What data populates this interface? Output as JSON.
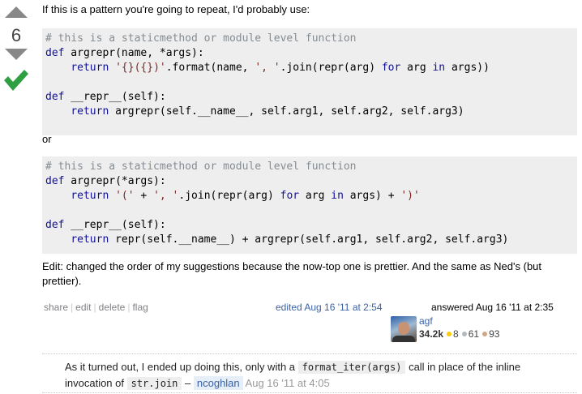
{
  "vote": {
    "count": "6"
  },
  "post": {
    "intro": "If this is a pattern you're going to repeat, I'd probably use:",
    "or": "or",
    "edit_note": "Edit: changed the order of my suggestions because the now-top one is prettier. And the same as Ned's (but prettier)."
  },
  "code1": {
    "l1": "# this is a staticmethod or module level function",
    "l2_kw": "def",
    "l2_rest": " argrepr(name, *args):",
    "l3_a": "    ",
    "l3_kw": "return",
    "l3_sp": " ",
    "l3_st1": "'{}({})'",
    "l3_m1": ".format(name, ",
    "l3_st2": "', '",
    "l3_m2": ".join(repr(arg) ",
    "l3_for": "for",
    "l3_m3": " arg ",
    "l3_in": "in",
    "l3_m4": " args))",
    "l5_kw": "def",
    "l5_rest": " __repr__(self):",
    "l6_a": "    ",
    "l6_kw": "return",
    "l6_rest": " argrepr(self.__name__, self.arg1, self.arg2, self.arg3)"
  },
  "code2": {
    "l1": "# this is a staticmethod or module level function",
    "l2_kw": "def",
    "l2_rest": " argrepr(*args):",
    "l3_a": "    ",
    "l3_kw": "return",
    "l3_sp": " ",
    "l3_st1": "'('",
    "l3_m1": " + ",
    "l3_st2": "', '",
    "l3_m2": ".join(repr(arg) ",
    "l3_for": "for",
    "l3_m3": " arg ",
    "l3_in": "in",
    "l3_m4": " args) + ",
    "l3_st3": "')'",
    "l5_kw": "def",
    "l5_rest": " __repr__(self):",
    "l6_a": "    ",
    "l6_kw": "return",
    "l6_rest": " repr(self.__name__) + argrepr(self.arg1, self.arg2, self.arg3)"
  },
  "menu": {
    "share": "share",
    "edit": "edit",
    "delete": "delete",
    "flag": "flag"
  },
  "edited": "edited Aug 16 '11 at 2:54",
  "answered": "answered Aug 16 '11 at 2:35",
  "user": {
    "name": "agf",
    "rep": "34.2k",
    "gold": "8",
    "silver": "61",
    "bronze": "93"
  },
  "colors": {
    "link": "#3b63a8",
    "code_bg": "#eeeeee",
    "accept": "#2fa042"
  },
  "comment": {
    "t1": "As it turned out, I ended up doing this, only with a ",
    "c1": "format_iter(args)",
    "t2": " call in place of the inline invocation of ",
    "c2": "str.join",
    "dash": " – ",
    "user": "ncoghlan",
    "date": " Aug 16 '11 at 4:05"
  }
}
